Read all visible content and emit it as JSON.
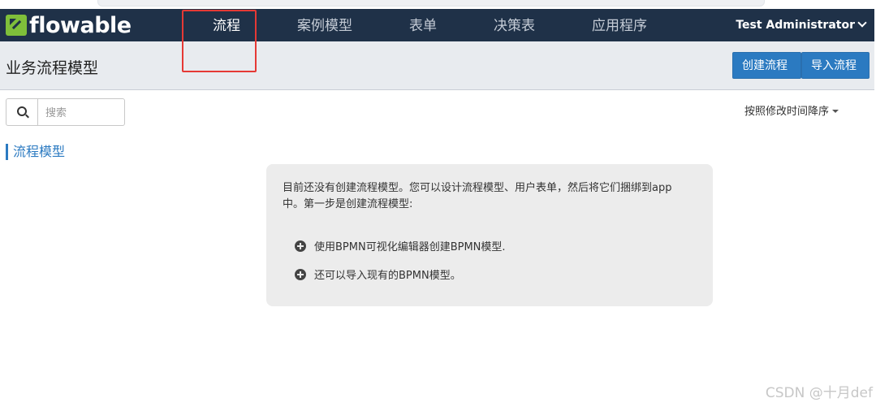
{
  "app": {
    "logo_text": "flowable"
  },
  "nav": {
    "items": [
      {
        "label": "流程",
        "active": true
      },
      {
        "label": "案例模型"
      },
      {
        "label": "表单"
      },
      {
        "label": "决策表"
      },
      {
        "label": "应用程序"
      }
    ],
    "user": "Test Administrator"
  },
  "header": {
    "title": "业务流程模型",
    "create_button": "创建流程",
    "import_button": "导入流程"
  },
  "search": {
    "placeholder": "搜索",
    "value": ""
  },
  "sort": {
    "label": "按照修改时间降序"
  },
  "section": {
    "title": "流程模型"
  },
  "empty_state": {
    "message": "目前还没有创建流程模型。您可以设计流程模型、用户表单，然后将它们捆绑到app中。第一步是创建流程模型:",
    "option1": "使用BPMN可视化编辑器创建BPMN模型.",
    "option2": "还可以导入现有的BPMN模型。"
  },
  "watermark": "CSDN @十月def",
  "colors": {
    "navbar": "#1f3148",
    "accent": "#2b7ac1",
    "logo_green": "#7fbf3a",
    "highlight_box": "#e53935"
  }
}
